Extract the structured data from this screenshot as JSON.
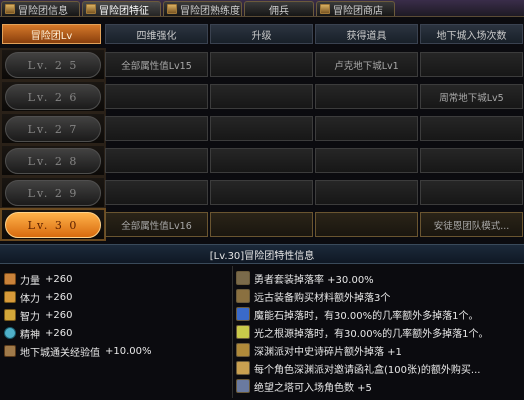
{
  "tabs": [
    "冒险团信息",
    "冒险团特征",
    "冒险团熟练度",
    "佣兵",
    "冒险团商店"
  ],
  "headers": {
    "level": "冒险团Lv",
    "stat4": "四维强化",
    "upgrade": "升级",
    "obtain": "获得道具",
    "entry": "地下城入场次数"
  },
  "levels": [
    {
      "label": "Lv. 2 5",
      "stat4": "全部属性值Lv15",
      "upgrade": "",
      "obtain": "卢克地下城Lv1",
      "entry": ""
    },
    {
      "label": "Lv. 2 6",
      "stat4": "",
      "upgrade": "",
      "obtain": "",
      "entry": "周常地下城Lv5"
    },
    {
      "label": "Lv. 2 7",
      "stat4": "",
      "upgrade": "",
      "obtain": "",
      "entry": ""
    },
    {
      "label": "Lv. 2 8",
      "stat4": "",
      "upgrade": "",
      "obtain": "",
      "entry": ""
    },
    {
      "label": "Lv. 2 9",
      "stat4": "",
      "upgrade": "",
      "obtain": "",
      "entry": ""
    },
    {
      "label": "Lv. 3 0",
      "stat4": "全部属性值Lv16",
      "upgrade": "",
      "obtain": "",
      "entry": "安徒恩团队模式..."
    }
  ],
  "info_title": "[Lv.30]冒险团特性信息",
  "stats": [
    {
      "name": "力量",
      "value": "+260",
      "icon": "strength-icon",
      "color": "#c9823a"
    },
    {
      "name": "体力",
      "value": "+260",
      "icon": "vitality-icon",
      "color": "#d89a3a"
    },
    {
      "name": "智力",
      "value": "+260",
      "icon": "intelligence-icon",
      "color": "#d4a83a"
    },
    {
      "name": "精神",
      "value": "+260",
      "icon": "spirit-icon",
      "color": "#4fb0c9"
    },
    {
      "name": "地下城通关经验值",
      "value": "+10.00%",
      "icon": "exp-icon",
      "color": "#a07a4a"
    }
  ],
  "bonuses": [
    {
      "text": "勇者套装掉落率 +30.00%",
      "icon": "armor-set-icon",
      "color": "#7a6a4a"
    },
    {
      "text": "远古装备购买材料额外掉落3个",
      "icon": "ancient-gear-icon",
      "color": "#8a7040"
    },
    {
      "text": "魔能石掉落时，有30.00%的几率额外多掉落1个。",
      "icon": "magic-stone-icon",
      "color": "#3a6ac9"
    },
    {
      "text": "光之根源掉落时，有30.00%的几率额外多掉落1个。",
      "icon": "light-root-icon",
      "color": "#c9c94a"
    },
    {
      "text": "深渊派对中史诗碎片额外掉落 +1",
      "icon": "epic-shard-icon",
      "color": "#b08a3a"
    },
    {
      "text": "每个角色深渊派对邀请函礼盒(100张)的额外购买...",
      "icon": "invite-box-icon",
      "color": "#c9a050"
    },
    {
      "text": "绝望之塔可入场角色数 +5",
      "icon": "tower-icon",
      "color": "#6a7aa0"
    }
  ]
}
